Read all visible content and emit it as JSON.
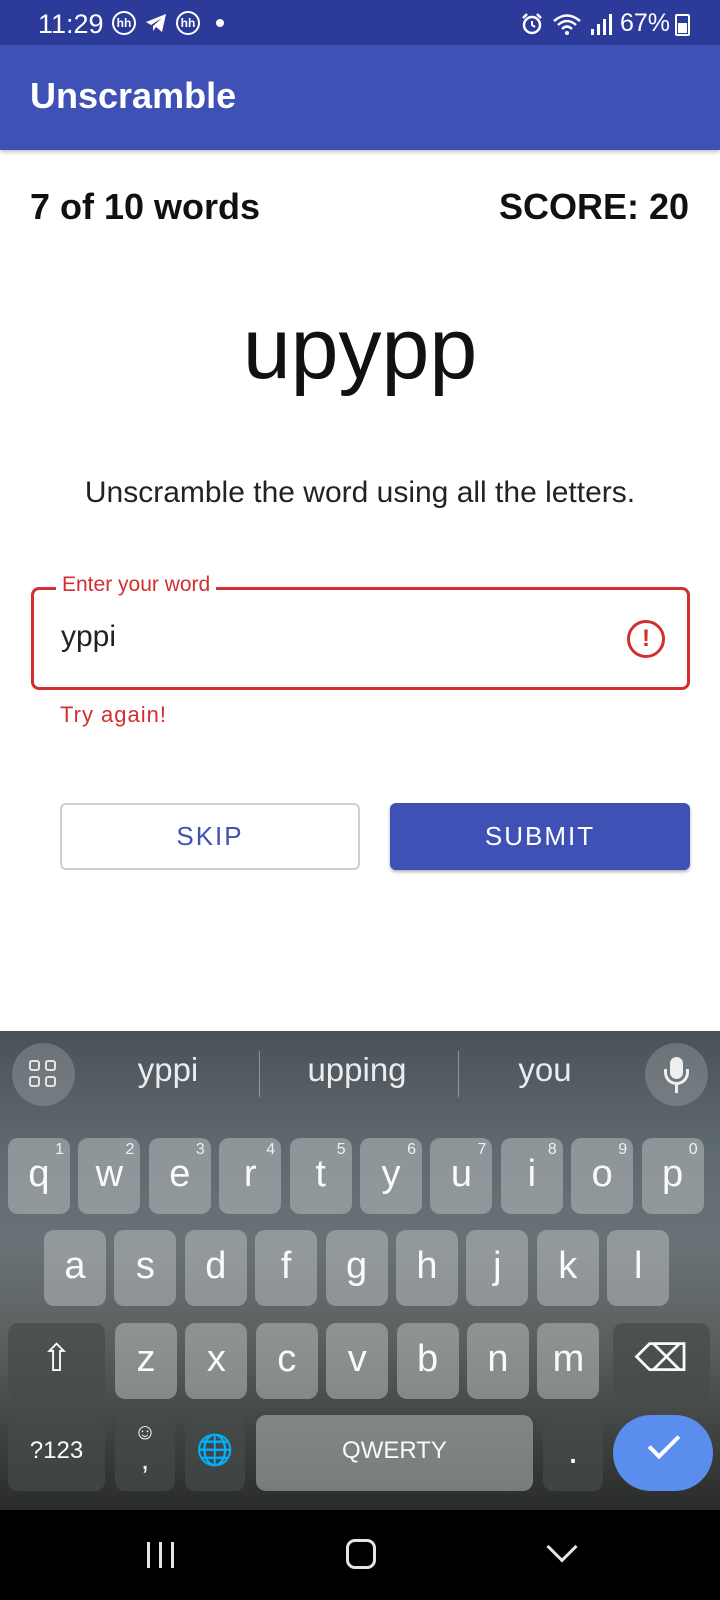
{
  "status_bar": {
    "time": "11:29",
    "battery": "67%",
    "icons": [
      "hh-icon",
      "telegram-icon",
      "hh-icon",
      "dot-icon",
      "alarm-icon",
      "wifi-icon",
      "signal-icon",
      "battery-icon"
    ],
    "hh_glyph": "hh"
  },
  "app_bar": {
    "title": "Unscramble"
  },
  "game": {
    "progress": "7 of 10 words",
    "score": "SCORE: 20",
    "scrambled_word": "upypp",
    "instructions": "Unscramble the word using all the letters."
  },
  "input": {
    "label": "Enter your word",
    "value": "yppi",
    "error": "Try again!",
    "error_icon": "!"
  },
  "buttons": {
    "skip": "SKIP",
    "submit": "SUBMIT"
  },
  "keyboard": {
    "suggestions": [
      "yppi",
      "upping",
      "you"
    ],
    "row1": [
      {
        "k": "q",
        "h": "1"
      },
      {
        "k": "w",
        "h": "2"
      },
      {
        "k": "e",
        "h": "3"
      },
      {
        "k": "r",
        "h": "4"
      },
      {
        "k": "t",
        "h": "5"
      },
      {
        "k": "y",
        "h": "6"
      },
      {
        "k": "u",
        "h": "7"
      },
      {
        "k": "i",
        "h": "8"
      },
      {
        "k": "o",
        "h": "9"
      },
      {
        "k": "p",
        "h": "0"
      }
    ],
    "row2": [
      "a",
      "s",
      "d",
      "f",
      "g",
      "h",
      "j",
      "k",
      "l"
    ],
    "row3": [
      "z",
      "x",
      "c",
      "v",
      "b",
      "n",
      "m"
    ],
    "symbols_key": "?123",
    "comma_key": ",",
    "emoji_glyph": "☺",
    "space_label": "QWERTY",
    "period_key": ".",
    "shift_glyph": "⇧",
    "backspace_glyph": "⌫",
    "globe_glyph": "🌐",
    "accent_color": "#5b8def"
  },
  "colors": {
    "primary": "#3f51b5",
    "error": "#d32f2f",
    "status_bar": "#2c3a99"
  }
}
